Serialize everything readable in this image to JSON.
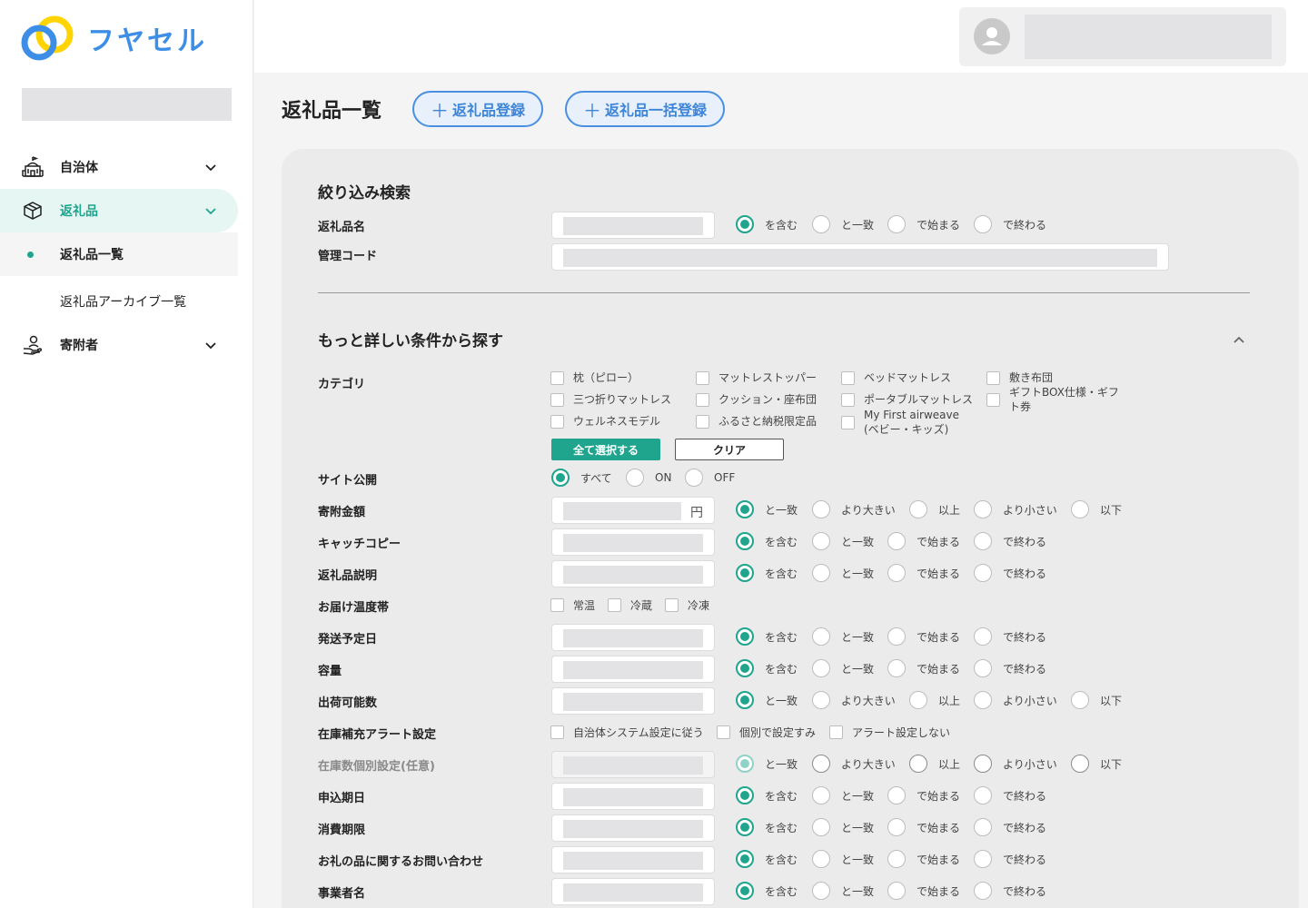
{
  "brand": {
    "logo_text": "フヤセル"
  },
  "sidebar": {
    "nav": [
      {
        "label": "自治体"
      },
      {
        "label": "返礼品"
      },
      {
        "label": "寄附者"
      }
    ],
    "sub": [
      {
        "label": "返礼品一覧"
      },
      {
        "label": "返礼品アーカイブ一覧"
      }
    ]
  },
  "page": {
    "title": "返礼品一覧",
    "register_button": "返礼品登録",
    "bulk_register_button": "返礼品一括登録",
    "plus": "＋"
  },
  "filter": {
    "title": "絞り込み検索",
    "name_label": "返礼品名",
    "code_label": "管理コード",
    "advanced_title": "もっと詳しい条件から探す",
    "category_label": "カテゴリ",
    "categories": [
      "枕（ピロー）",
      "三つ折りマットレス",
      "ウェルネスモデル",
      "マットレストッパー",
      "クッション・座布団",
      "ふるさと納税限定品",
      "ベッドマットレス",
      "ポータブルマットレス",
      "My First airweave (ベビー・キッズ)",
      "敷き布団",
      "ギフトBOX仕様・ギフト券"
    ],
    "select_all": "全て選択する",
    "clear": "クリア",
    "site_public_label": "サイト公開",
    "site_public_options": [
      "すべて",
      "ON",
      "OFF"
    ],
    "donation_label": "寄附金額",
    "yen": "円",
    "catch_label": "キャッチコピー",
    "desc_label": "返礼品説明",
    "temp_label": "お届け温度帯",
    "temp_options": [
      "常温",
      "冷蔵",
      "冷凍"
    ],
    "ship_label": "発送予定日",
    "capacity_label": "容量",
    "stock_label": "出荷可能数",
    "alert_label": "在庫補充アラート設定",
    "alert_options": [
      "自治体システム設定に従う",
      "個別で設定すみ",
      "アラート設定しない"
    ],
    "stock_individual_label": "在庫数個別設定(任意)",
    "apply_label": "申込期日",
    "expiry_label": "消費期限",
    "inquiry_label": "お礼の品に関するお問い合わせ",
    "business_label": "事業者名",
    "text_match": [
      "を含む",
      "と一致",
      "で始まる",
      "で終わる"
    ],
    "num_match": [
      "と一致",
      "より大きい",
      "以上",
      "より小さい",
      "以下"
    ]
  }
}
